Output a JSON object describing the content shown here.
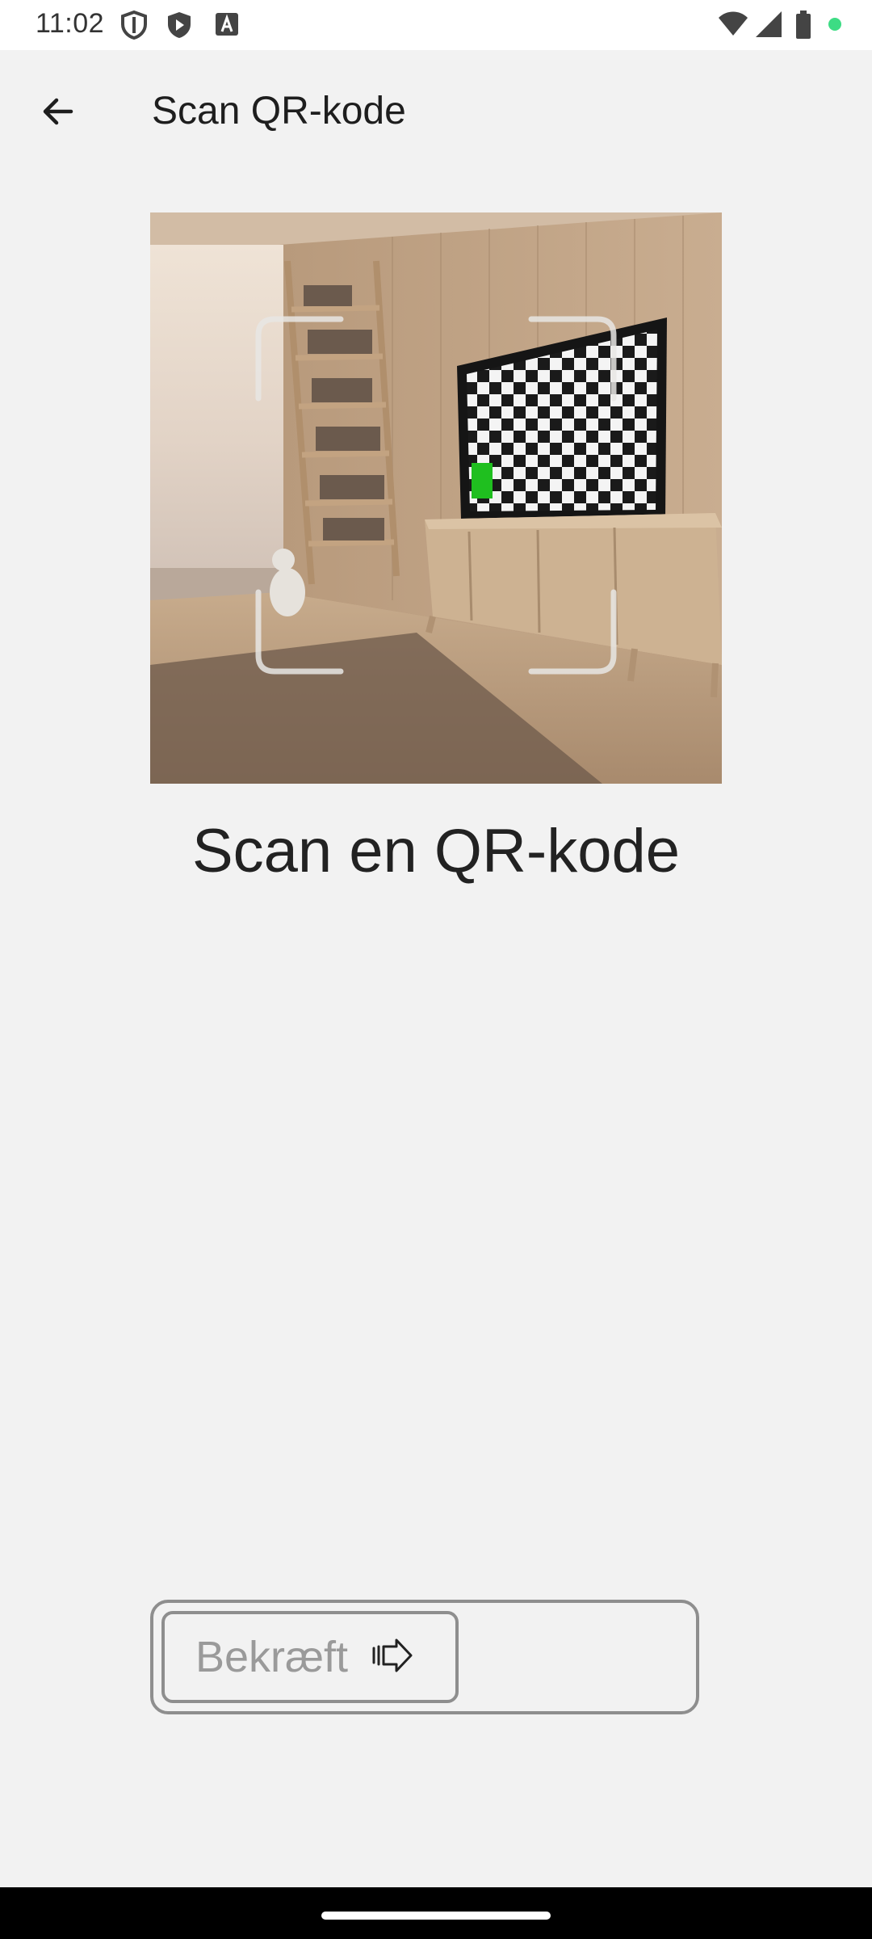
{
  "status_bar": {
    "time": "11:02",
    "icons": [
      "shield-icon",
      "play-protect-icon",
      "font-icon",
      "wifi-icon",
      "signal-icon",
      "battery-icon"
    ],
    "dot_color": "#3ddc84"
  },
  "app_bar": {
    "title": "Scan QR-kode",
    "back_icon": "arrow-left-icon"
  },
  "main": {
    "heading": "Scan en QR-kode"
  },
  "confirm": {
    "label": "Bekræft",
    "icon": "hand-pointing-right-icon"
  },
  "colors": {
    "background": "#f2f2f2",
    "text": "#222222",
    "disabled": "#9a9a9a",
    "tv_marker": "#1fbf1f"
  }
}
